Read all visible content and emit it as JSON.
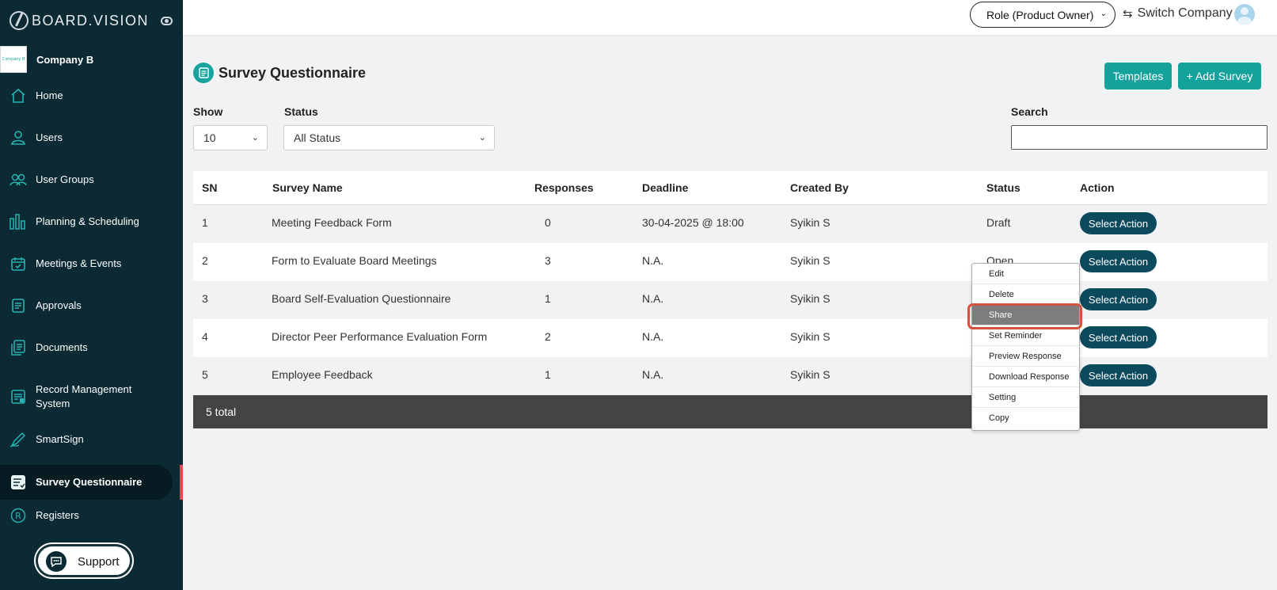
{
  "brand": {
    "name": "BOARD.VISION",
    "company_logo_text": "Company B",
    "company_name": "Company B"
  },
  "sidebar": {
    "items": [
      {
        "label": "Home",
        "icon": "home-icon"
      },
      {
        "label": "Users",
        "icon": "user-icon"
      },
      {
        "label": "User Groups",
        "icon": "user-group-icon"
      },
      {
        "label": "Planning & Scheduling",
        "icon": "bar-chart-icon"
      },
      {
        "label": "Meetings & Events",
        "icon": "calendar-icon"
      },
      {
        "label": "Approvals",
        "icon": "approval-doc-icon"
      },
      {
        "label": "Documents",
        "icon": "documents-icon"
      },
      {
        "label": "Record Management System",
        "icon": "record-icon"
      },
      {
        "label": "SmartSign",
        "icon": "pen-icon"
      },
      {
        "label": "Survey Questionnaire",
        "icon": "survey-icon",
        "active": true
      },
      {
        "label": "Registers",
        "icon": "registered-icon"
      }
    ],
    "support_label": "Support"
  },
  "header": {
    "role": "Role (Product Owner)",
    "switch_company": "Switch Company"
  },
  "page": {
    "title": "Survey Questionnaire",
    "templates_button": "Templates",
    "add_button": "+ Add Survey"
  },
  "filters": {
    "show_label": "Show",
    "show_value": "10",
    "status_label": "Status",
    "status_value": "All Status",
    "search_label": "Search",
    "search_value": ""
  },
  "table": {
    "columns": [
      "SN",
      "Survey Name",
      "Responses",
      "Deadline",
      "Created By",
      "Status",
      "Action"
    ],
    "rows": [
      {
        "sn": "1",
        "name": "Meeting Feedback Form",
        "responses": "0",
        "deadline": "30-04-2025 @ 18:00",
        "created_by": "Syikin S",
        "status": "Draft",
        "action": "Select Action"
      },
      {
        "sn": "2",
        "name": "Form to Evaluate Board Meetings",
        "responses": "3",
        "deadline": "N.A.",
        "created_by": "Syikin S",
        "status": "Open",
        "action": "Select Action"
      },
      {
        "sn": "3",
        "name": "Board Self-Evaluation Questionnaire",
        "responses": "1",
        "deadline": "N.A.",
        "created_by": "Syikin S",
        "status": "",
        "action": "Select Action"
      },
      {
        "sn": "4",
        "name": "Director Peer Performance Evaluation Form",
        "responses": "2",
        "deadline": "N.A.",
        "created_by": "Syikin S",
        "status": "",
        "action": "Select Action"
      },
      {
        "sn": "5",
        "name": "Employee Feedback",
        "responses": "1",
        "deadline": "N.A.",
        "created_by": "Syikin S",
        "status": "",
        "action": "Select Action"
      }
    ],
    "footer": "5 total"
  },
  "action_menu": {
    "items": [
      "Edit",
      "Delete",
      "Share",
      "Set Reminder",
      "Preview Response",
      "Download Response",
      "Setting",
      "Copy"
    ],
    "highlighted": "Share"
  },
  "colors": {
    "sidebar": "#0b2a33",
    "accent": "#14a29d",
    "action_button": "#0c4a5e",
    "highlight_ring": "#d8533f"
  }
}
